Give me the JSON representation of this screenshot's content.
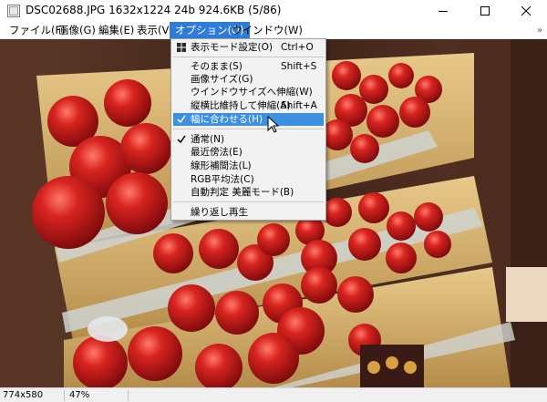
{
  "window": {
    "title": "DSC02688.JPG 1632x1224 24b 924.6KB (5/86)",
    "icons": [
      "app-icon",
      "minimize-icon",
      "maximize-icon",
      "close-icon"
    ]
  },
  "menubar": {
    "items": [
      "ファイル(F)",
      "画像(G)",
      "編集(E)",
      "表示(V)",
      "オプション(O)",
      "ウインドウ(W)"
    ],
    "overflow": "»",
    "accent_color": "#2e7bd8"
  },
  "dropdown": {
    "items": [
      {
        "label": "表示モード設定(O)",
        "shortcut": "Ctrl+O",
        "icon": "grid-icon"
      },
      {
        "label": "そのまま(S)",
        "shortcut": "Shift+S"
      },
      {
        "label": "画像サイズ(G)",
        "shortcut": ""
      },
      {
        "label": "ウインドウサイズへ伸縮(W)",
        "shortcut": ""
      },
      {
        "label": "縦横比維持して伸縮(A)",
        "shortcut": "Shift+A"
      },
      {
        "label": "幅に合わせる(H)",
        "shortcut": "",
        "checked": true,
        "highlighted": true
      },
      {
        "label": "通常(N)",
        "shortcut": "",
        "checked": true
      },
      {
        "label": "最近傍法(E)",
        "shortcut": ""
      },
      {
        "label": "線形補間法(L)",
        "shortcut": ""
      },
      {
        "label": "RGB平均法(C)",
        "shortcut": ""
      },
      {
        "label": "自動判定 美麗モード(B)",
        "shortcut": ""
      },
      {
        "label": "繰り返し再生",
        "shortcut": ""
      }
    ],
    "highlight_color": "#3d8fe2"
  },
  "statusbar": {
    "dimensions": "774x580",
    "zoom": "47%"
  },
  "image": {
    "subject": "tomatoes on wooden shelves",
    "colors": {
      "tomato": "#c8141a",
      "straw": "#d8b46a",
      "wood": "#4a2c1f",
      "glass": "#cfd3d2"
    }
  }
}
